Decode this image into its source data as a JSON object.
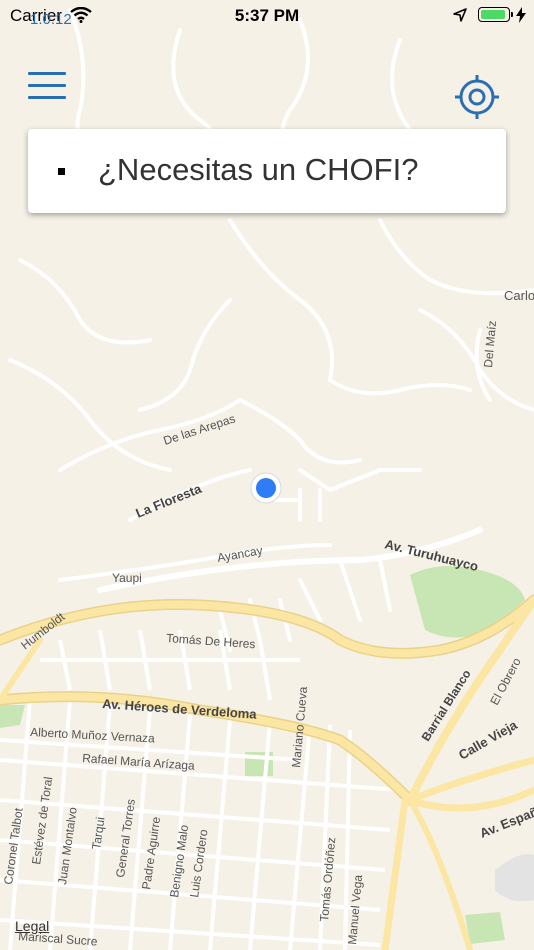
{
  "status_bar": {
    "carrier": "Carrier",
    "version": "1.0.12",
    "time": "5:37 PM"
  },
  "card": {
    "text": "¿Necesitas un CHOFI?"
  },
  "map": {
    "legal": "Legal",
    "streets": {
      "carlo": "Carlo",
      "del_maiz": "Del Maíz",
      "de_las_arepas": "De las Arepas",
      "la_floresta": "La Floresta",
      "ayancay": "Ayancay",
      "av_turuhuayco": "Av. Turuhuayco",
      "yaupi": "Yaupi",
      "humboldt": "Humboldt",
      "tomas_de_heres": "Tomás De Heres",
      "av_heroes": "Av. Héroes de Verdeloma",
      "alberto": "Alberto Muñoz Vernaza",
      "rafael": "Rafael María Arízaga",
      "mariano": "Mariano Cueva",
      "barrial": "Barrial Blanco",
      "el_obrero": "El Obrero",
      "calle_vieja": "Calle Vieja",
      "av_espana": "Av. España",
      "coronel": "Coronel Talbot",
      "estevez": "Estévez de Toral",
      "juan": "Juan Montalvo",
      "tarqui": "Tarqui",
      "general": "General Torres",
      "padre": "Padre Aguirre",
      "benigno": "Benigno Malo",
      "luis": "Luis Cordero",
      "tomas_o": "Tomás Ordóñez",
      "manuel": "Manuel Vega",
      "mariscal": "Mariscal Sucre"
    }
  },
  "colors": {
    "accent": "#2a6fb6",
    "map_bg": "#f6f1e7",
    "major_road": "#fbe6a3",
    "park": "#c8e6b4",
    "user_dot": "#2f7df6"
  },
  "icons": {
    "menu": "hamburger-menu-icon",
    "target": "crosshair-target-icon",
    "wifi": "wifi-icon",
    "location": "location-arrow-icon",
    "battery": "battery-icon",
    "bolt": "charging-bolt-icon"
  }
}
